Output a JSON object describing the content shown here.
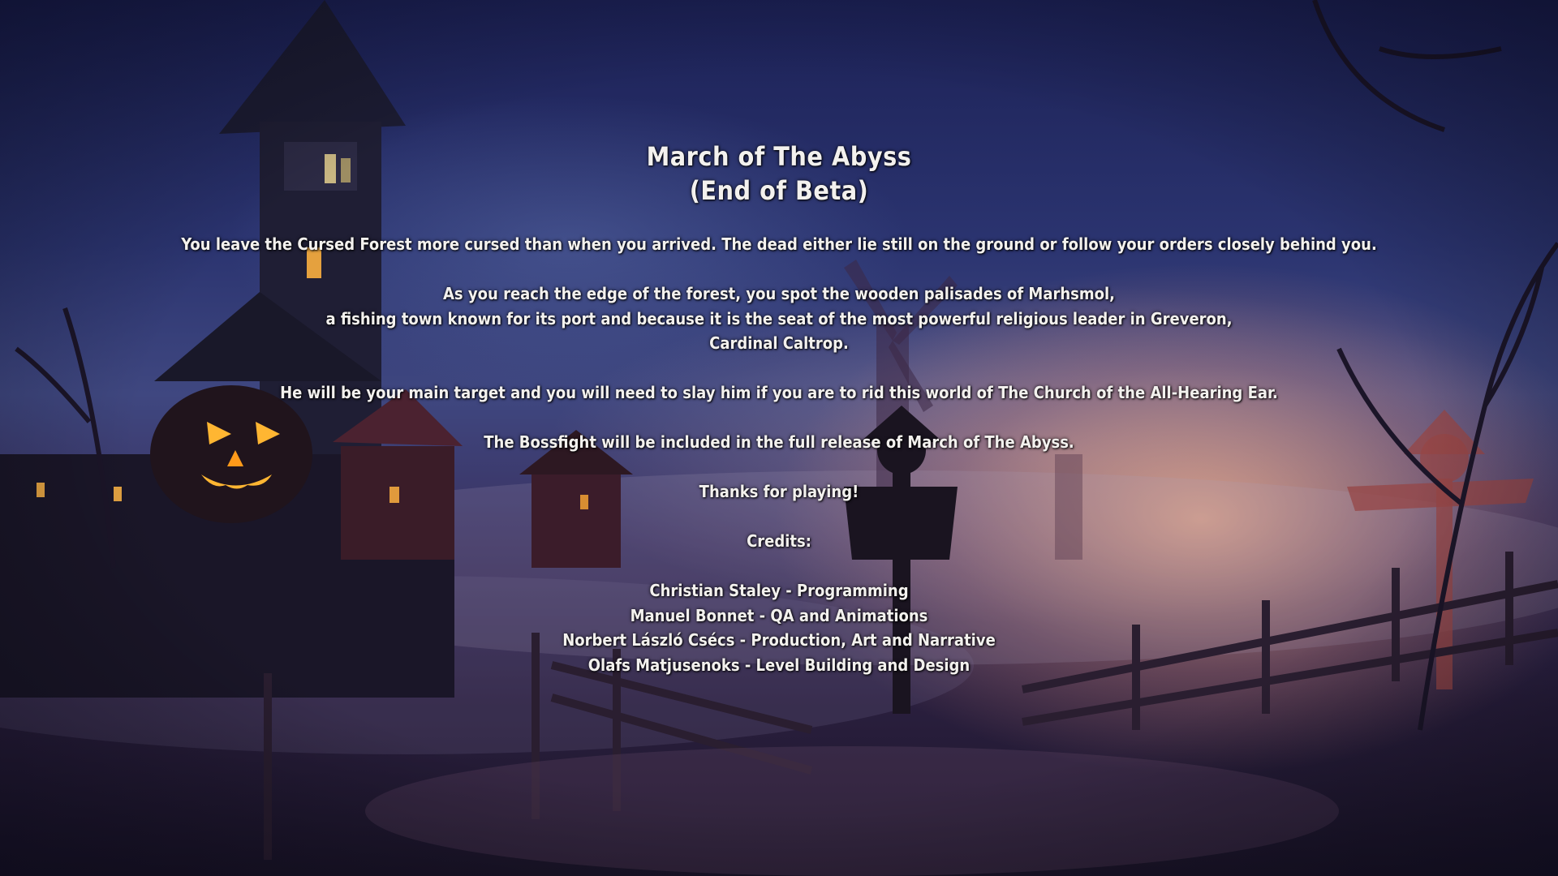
{
  "screen": {
    "title_line_1": "March of The Abyss",
    "title_line_2": "(End of Beta)",
    "paragraph_1": "You leave the Cursed Forest more cursed than when you arrived. The dead either lie still on the ground or follow your orders closely behind you.",
    "paragraph_2": [
      "As you reach the edge of the forest, you spot the wooden palisades of Marhsmol,",
      "a fishing town known for its port and because it is the seat of the most powerful religious leader in Greveron,",
      "Cardinal Caltrop."
    ],
    "paragraph_3": "He will be your main target and you will need to slay him if you are to rid this world of The Church of the All-Hearing Ear.",
    "paragraph_4": "The Bossfight will be included in the full release of March of The Abyss.",
    "thanks": "Thanks for playing!",
    "credits_heading": "Credits:",
    "credits": [
      "Christian Staley - Programming",
      "Manuel Bonnet - QA and Animations",
      "Norbert László Csécs - Production, Art and Narrative",
      "Olafs Matjusenoks - Level Building and Design"
    ]
  },
  "colors": {
    "text": "#f3f1ee",
    "sky_top": "#1c2156",
    "sunset_glow": "#e8aa8c",
    "pumpkin": "#ff9a1a"
  }
}
